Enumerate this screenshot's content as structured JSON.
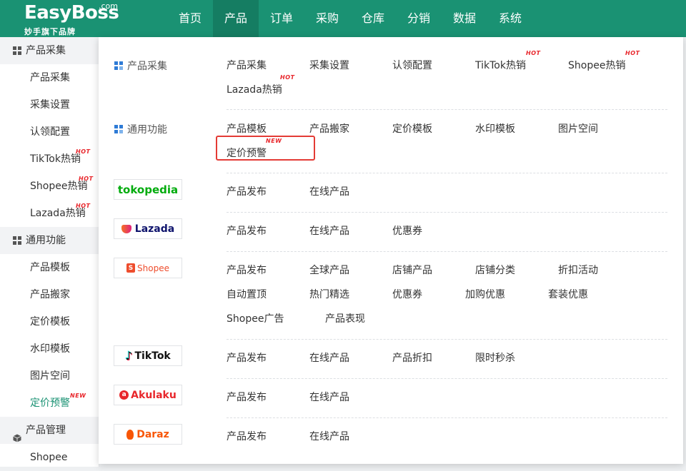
{
  "header": {
    "logo_main": "EasyBoss",
    "logo_com": ".com",
    "logo_sub": "妙手旗下品牌",
    "nav": [
      "首页",
      "产品",
      "订单",
      "采购",
      "仓库",
      "分销",
      "数据",
      "系统"
    ],
    "active_nav": "产品"
  },
  "sidebar": {
    "group1": "产品采集",
    "g1_items": [
      {
        "label": "产品采集",
        "badge": ""
      },
      {
        "label": "采集设置",
        "badge": ""
      },
      {
        "label": "认领配置",
        "badge": ""
      },
      {
        "label": "TikTok热销",
        "badge": "HOT"
      },
      {
        "label": "Shopee热销",
        "badge": "HOT"
      },
      {
        "label": "Lazada热销",
        "badge": "HOT"
      }
    ],
    "group2": "通用功能",
    "g2_items": [
      {
        "label": "产品模板",
        "badge": ""
      },
      {
        "label": "产品搬家",
        "badge": ""
      },
      {
        "label": "定价模板",
        "badge": ""
      },
      {
        "label": "水印模板",
        "badge": ""
      },
      {
        "label": "图片空间",
        "badge": ""
      },
      {
        "label": "定价预警",
        "badge": "NEW"
      }
    ],
    "group3": "产品管理",
    "g3_items": [
      {
        "label": "Shopee",
        "badge": ""
      }
    ]
  },
  "panel": {
    "collect": {
      "label": "产品采集",
      "links": [
        {
          "label": "产品采集",
          "badge": ""
        },
        {
          "label": "采集设置",
          "badge": ""
        },
        {
          "label": "认领配置",
          "badge": ""
        },
        {
          "label": "TikTok热销",
          "badge": "HOT"
        },
        {
          "label": "Shopee热销",
          "badge": "HOT"
        },
        {
          "label": "Lazada热销",
          "badge": "HOT"
        }
      ]
    },
    "common": {
      "label": "通用功能",
      "links": [
        {
          "label": "产品模板",
          "badge": ""
        },
        {
          "label": "产品搬家",
          "badge": ""
        },
        {
          "label": "定价模板",
          "badge": ""
        },
        {
          "label": "水印模板",
          "badge": ""
        },
        {
          "label": "图片空间",
          "badge": ""
        },
        {
          "label": "定价预警",
          "badge": "NEW"
        }
      ]
    },
    "tokopedia": {
      "logo": "tokopedia",
      "color": "#03ac0e",
      "links": [
        "产品发布",
        "在线产品"
      ]
    },
    "lazada": {
      "logo": "Lazada",
      "color": "#0f146d",
      "links": [
        "产品发布",
        "在线产品",
        "优惠券"
      ]
    },
    "shopee": {
      "logo": "Shopee",
      "color": "#ee4d2d",
      "links": [
        "产品发布",
        "全球产品",
        "店铺产品",
        "店铺分类",
        "折扣活动",
        "自动置顶",
        "热门精选",
        "优惠券",
        "加购优惠",
        "套装优惠",
        "Shopee广告",
        "产品表现"
      ]
    },
    "tiktok": {
      "logo": "TikTok",
      "color": "#111111",
      "links": [
        "产品发布",
        "在线产品",
        "产品折扣",
        "限时秒杀"
      ]
    },
    "akulaku": {
      "logo": "Akulaku",
      "color": "#e8262b",
      "links": [
        "产品发布",
        "在线产品"
      ]
    },
    "daraz": {
      "logo": "Daraz",
      "color": "#f85606",
      "links": [
        "产品发布",
        "在线产品"
      ]
    }
  },
  "colors": {
    "brand": "#1a9273",
    "badge": "#e8262b",
    "highlight": "#e43b35"
  }
}
